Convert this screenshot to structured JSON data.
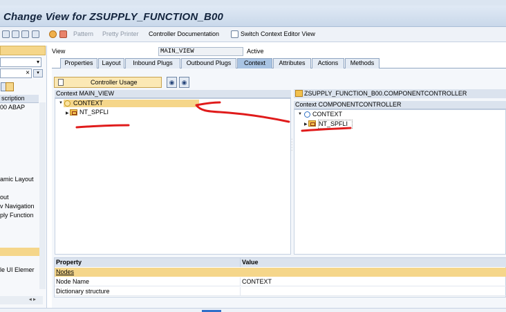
{
  "window": {
    "title": "Change View for ZSUPPLY_FUNCTION_B00"
  },
  "toolbar": {
    "pattern": "Pattern",
    "pretty_printer": "Pretty Printer",
    "controller_documentation": "Controller Documentation",
    "switch_context_editor": "Switch Context Editor View"
  },
  "left_panel": {
    "col_header": "scription",
    "rows": [
      "00 ABAP",
      "amic Layout",
      "out",
      "v Navigation",
      "ply Function",
      "le UI Elemer"
    ],
    "close_glyph": "×"
  },
  "view_header": {
    "label": "View",
    "value": "MAIN_VIEW",
    "status": "Active"
  },
  "tabs": [
    {
      "label": "Properties",
      "active": false
    },
    {
      "label": "Layout",
      "active": false
    },
    {
      "label": "Inbound Plugs",
      "active": false
    },
    {
      "label": "Outbound Plugs",
      "active": false
    },
    {
      "label": "Context",
      "active": true
    },
    {
      "label": "Attributes",
      "active": false
    },
    {
      "label": "Actions",
      "active": false
    },
    {
      "label": "Methods",
      "active": false
    }
  ],
  "context_editor": {
    "controller_usage_label": "Controller Usage",
    "left_title": "Context MAIN_VIEW",
    "left_root": "CONTEXT",
    "left_child": "NT_SPFLI",
    "right_component": "ZSUPPLY_FUNCTION_B00.COMPONENTCONTROLLER",
    "right_title": "Context COMPONENTCONTROLLER",
    "right_root": "CONTEXT",
    "right_child": "NT_SPFLI"
  },
  "properties": {
    "col_property": "Property",
    "col_value": "Value",
    "group": "Nodes",
    "rows": [
      {
        "property": "Node Name",
        "value": "CONTEXT"
      },
      {
        "property": "Dictionary structure",
        "value": ""
      }
    ]
  },
  "colors": {
    "accent": "#f5d68a",
    "tab_active": "#a9c4e3",
    "annotation_red": "#e01b1b"
  }
}
